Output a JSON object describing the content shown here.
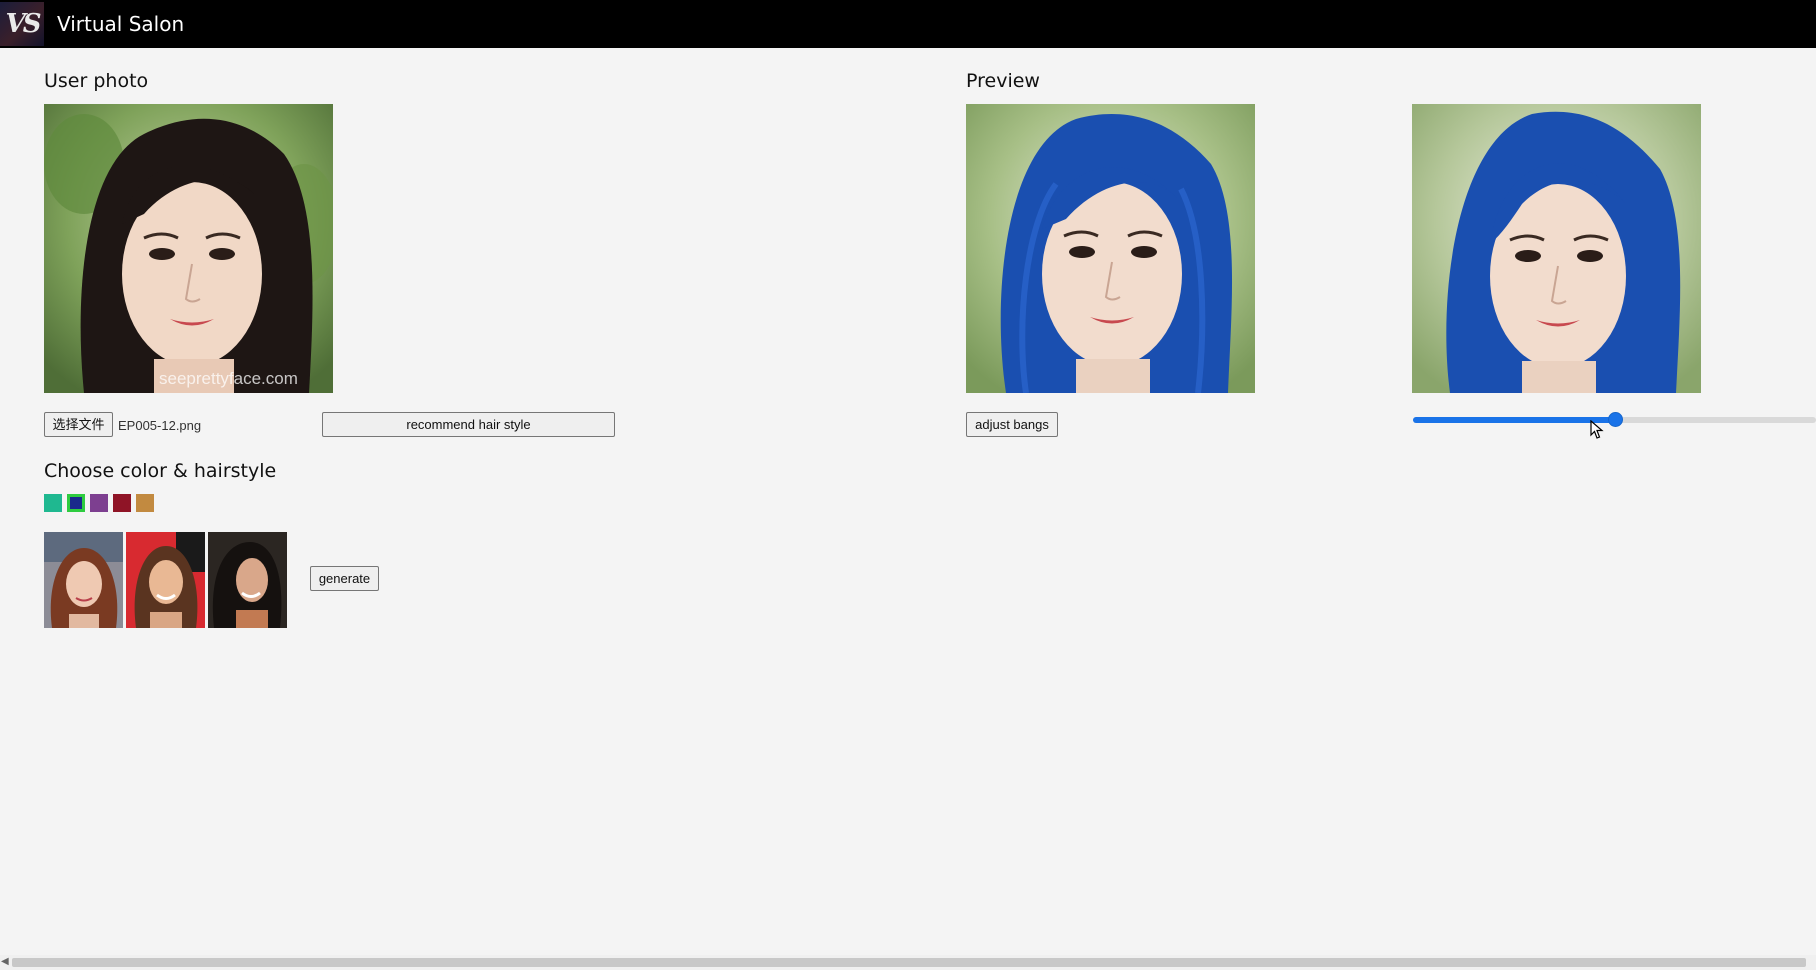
{
  "header": {
    "logo_text": "VS",
    "title": "Virtual Salon"
  },
  "user_photo": {
    "heading": "User photo",
    "watermark": "seeprettyface.com",
    "file_button_label": "选择文件",
    "file_name": "EP005-12.png",
    "recommend_label": "recommend hair style"
  },
  "choose": {
    "heading": "Choose color & hairstyle",
    "colors": [
      "#1fb890",
      "#1a2a8c",
      "#7d3f90",
      "#8f1426",
      "#c28a40"
    ],
    "selected_color_index": 1,
    "hairstyle_thumbnails": [
      "hairstyle-thumbnail-1",
      "hairstyle-thumbnail-2",
      "hairstyle-thumbnail-3"
    ],
    "generate_label": "generate"
  },
  "preview": {
    "heading": "Preview",
    "adjust_bangs_label": "adjust bangs",
    "hair_color": "#1a4fb0",
    "bangs_slider_value": 0.5
  },
  "colors": {
    "topbar": "#000000",
    "accent": "#1a73e8"
  }
}
